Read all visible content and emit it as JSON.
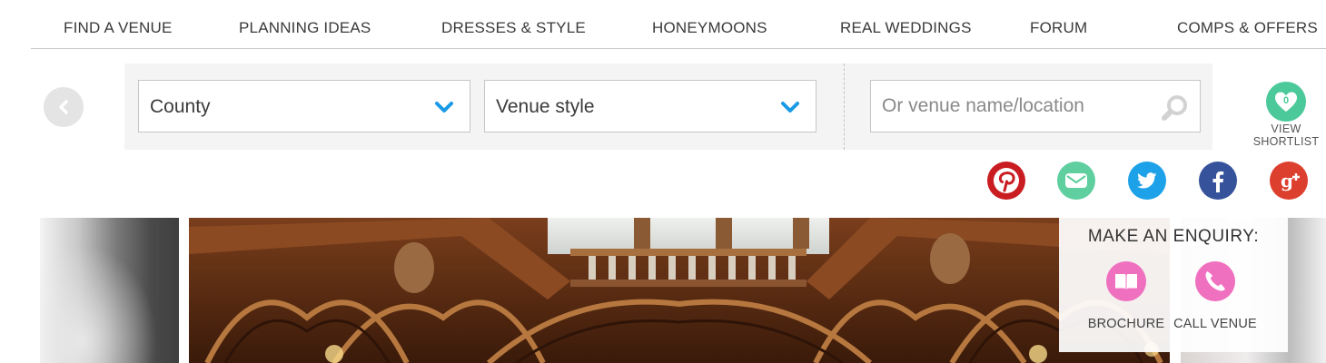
{
  "nav": {
    "items": [
      {
        "label": "FIND A VENUE"
      },
      {
        "label": "PLANNING IDEAS"
      },
      {
        "label": "DRESSES & STYLE"
      },
      {
        "label": "HONEYMOONS"
      },
      {
        "label": "REAL WEDDINGS"
      },
      {
        "label": "FORUM"
      },
      {
        "label": "COMPS & OFFERS"
      }
    ]
  },
  "search": {
    "county_label": "County",
    "venue_style_label": "Venue style",
    "venue_placeholder": "Or venue name/location"
  },
  "shortlist": {
    "count": "0",
    "label_line1": "VIEW",
    "label_line2": "SHORTLIST"
  },
  "social": {
    "items": [
      {
        "name": "pinterest",
        "color": "#c91d22"
      },
      {
        "name": "email",
        "color": "#5fcf9f"
      },
      {
        "name": "twitter",
        "color": "#1da1e8"
      },
      {
        "name": "facebook",
        "color": "#35529b"
      },
      {
        "name": "google-plus",
        "color": "#dd3f2e"
      }
    ]
  },
  "enquiry": {
    "title": "MAKE AN ENQUIRY:",
    "brochure_label": "BROCHURE",
    "call_label": "CALL VENUE"
  },
  "colors": {
    "accent_blue": "#1a9ae6",
    "shortlist_green": "#4cc99a",
    "enquiry_pink": "#f070c0"
  }
}
